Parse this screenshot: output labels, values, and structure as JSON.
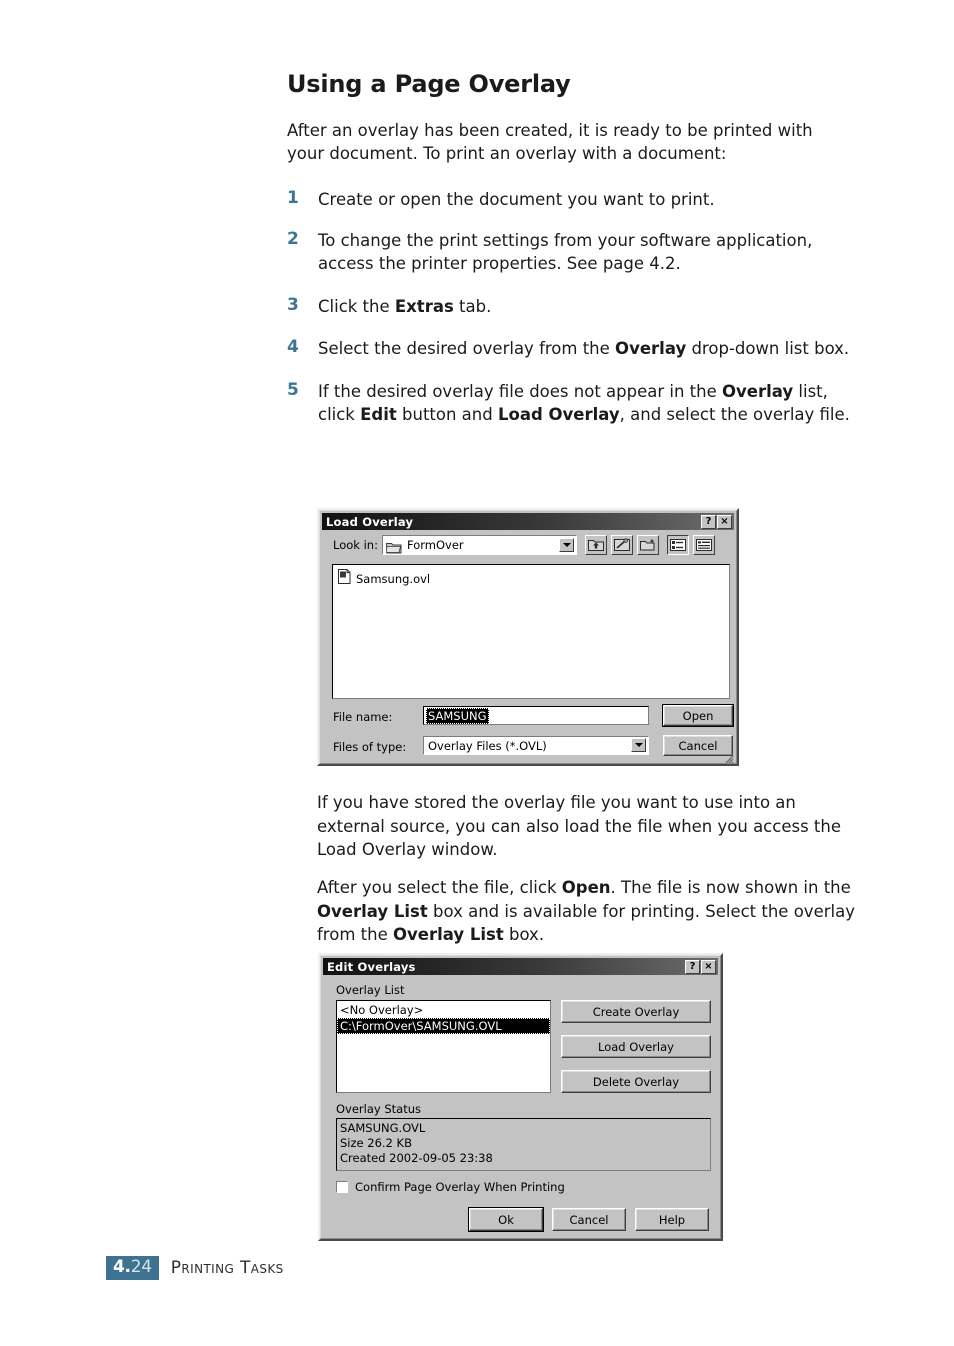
{
  "page": {
    "heading": "Using a Page Overlay",
    "intro": "After an overlay has been created, it is ready to be printed with your document. To print an overlay with a document:",
    "steps": [
      {
        "num": "1",
        "text": "Create or open the document you want to print."
      },
      {
        "num": "2",
        "text": "To change the print settings from your software application, access the printer properties. See page 4.2."
      },
      {
        "num": "3",
        "text": "Click the <b>Extras</b> tab."
      },
      {
        "num": "4",
        "text": "Select the desired overlay from the <b>Overlay</b> drop-down list box."
      },
      {
        "num": "5",
        "text": "If the desired overlay file does not appear in the <b>Overlay</b> list, click <b>Edit</b> button and <b>Load Overlay</b>, and select the overlay file."
      }
    ],
    "paragraph_1": "If you have stored the overlay file you want to use into an external source, you can also load the file when you access the Load Overlay window.",
    "paragraph_2": "After you select the file, click <b>Open</b>. The file is now shown in the <b>Overlay List</b> box and is available for printing. Select the overlay from the <b>Overlay List</b> box.",
    "accent_color": "#3b7794"
  },
  "footer": {
    "folio_major": "4.",
    "folio_minor": "24",
    "label": "Printing Tasks",
    "folio_bg": "#3d7390"
  },
  "load_overlay_dialog": {
    "title": "Load Overlay",
    "help_button": "?",
    "close_button": "×",
    "look_in_label": "Look in:",
    "look_in_value": "FormOver",
    "toolbar": [
      {
        "name": "up-one-level-icon",
        "tip": "Up One Level"
      },
      {
        "name": "look-in-favorites-icon",
        "tip": "Look in Favorites"
      },
      {
        "name": "new-folder-icon",
        "tip": "Create New Folder"
      },
      {
        "name": "list-view-icon",
        "tip": "List"
      },
      {
        "name": "details-view-icon",
        "tip": "Details"
      }
    ],
    "files": [
      {
        "name": "Samsung.ovl",
        "icon": "overlay-file-icon"
      }
    ],
    "file_name_label": "File name:",
    "file_name_value": "SAMSUNG",
    "files_of_type_label": "Files of type:",
    "files_of_type_value": "Overlay Files (*.OVL)",
    "open_button": "Open",
    "cancel_button": "Cancel"
  },
  "edit_overlays_dialog": {
    "title": "Edit Overlays",
    "help_button": "?",
    "close_button": "×",
    "overlay_list_label": "Overlay List",
    "overlay_list_items": [
      {
        "text": "<No Overlay>",
        "selected": false
      },
      {
        "text": "C:\\FormOver\\SAMSUNG.OVL",
        "selected": true
      }
    ],
    "side_buttons": [
      {
        "label": "Create Overlay"
      },
      {
        "label": "Load Overlay"
      },
      {
        "label": "Delete Overlay"
      }
    ],
    "overlay_status_label": "Overlay Status",
    "overlay_status_lines": [
      "SAMSUNG.OVL",
      "Size 26.2 KB",
      "Created 2002-09-05 23:38"
    ],
    "confirm_checkbox_label": "Confirm Page Overlay When Printing",
    "confirm_checkbox_checked": false,
    "ok_button": "Ok",
    "cancel_button": "Cancel",
    "help_button_label": "Help"
  }
}
